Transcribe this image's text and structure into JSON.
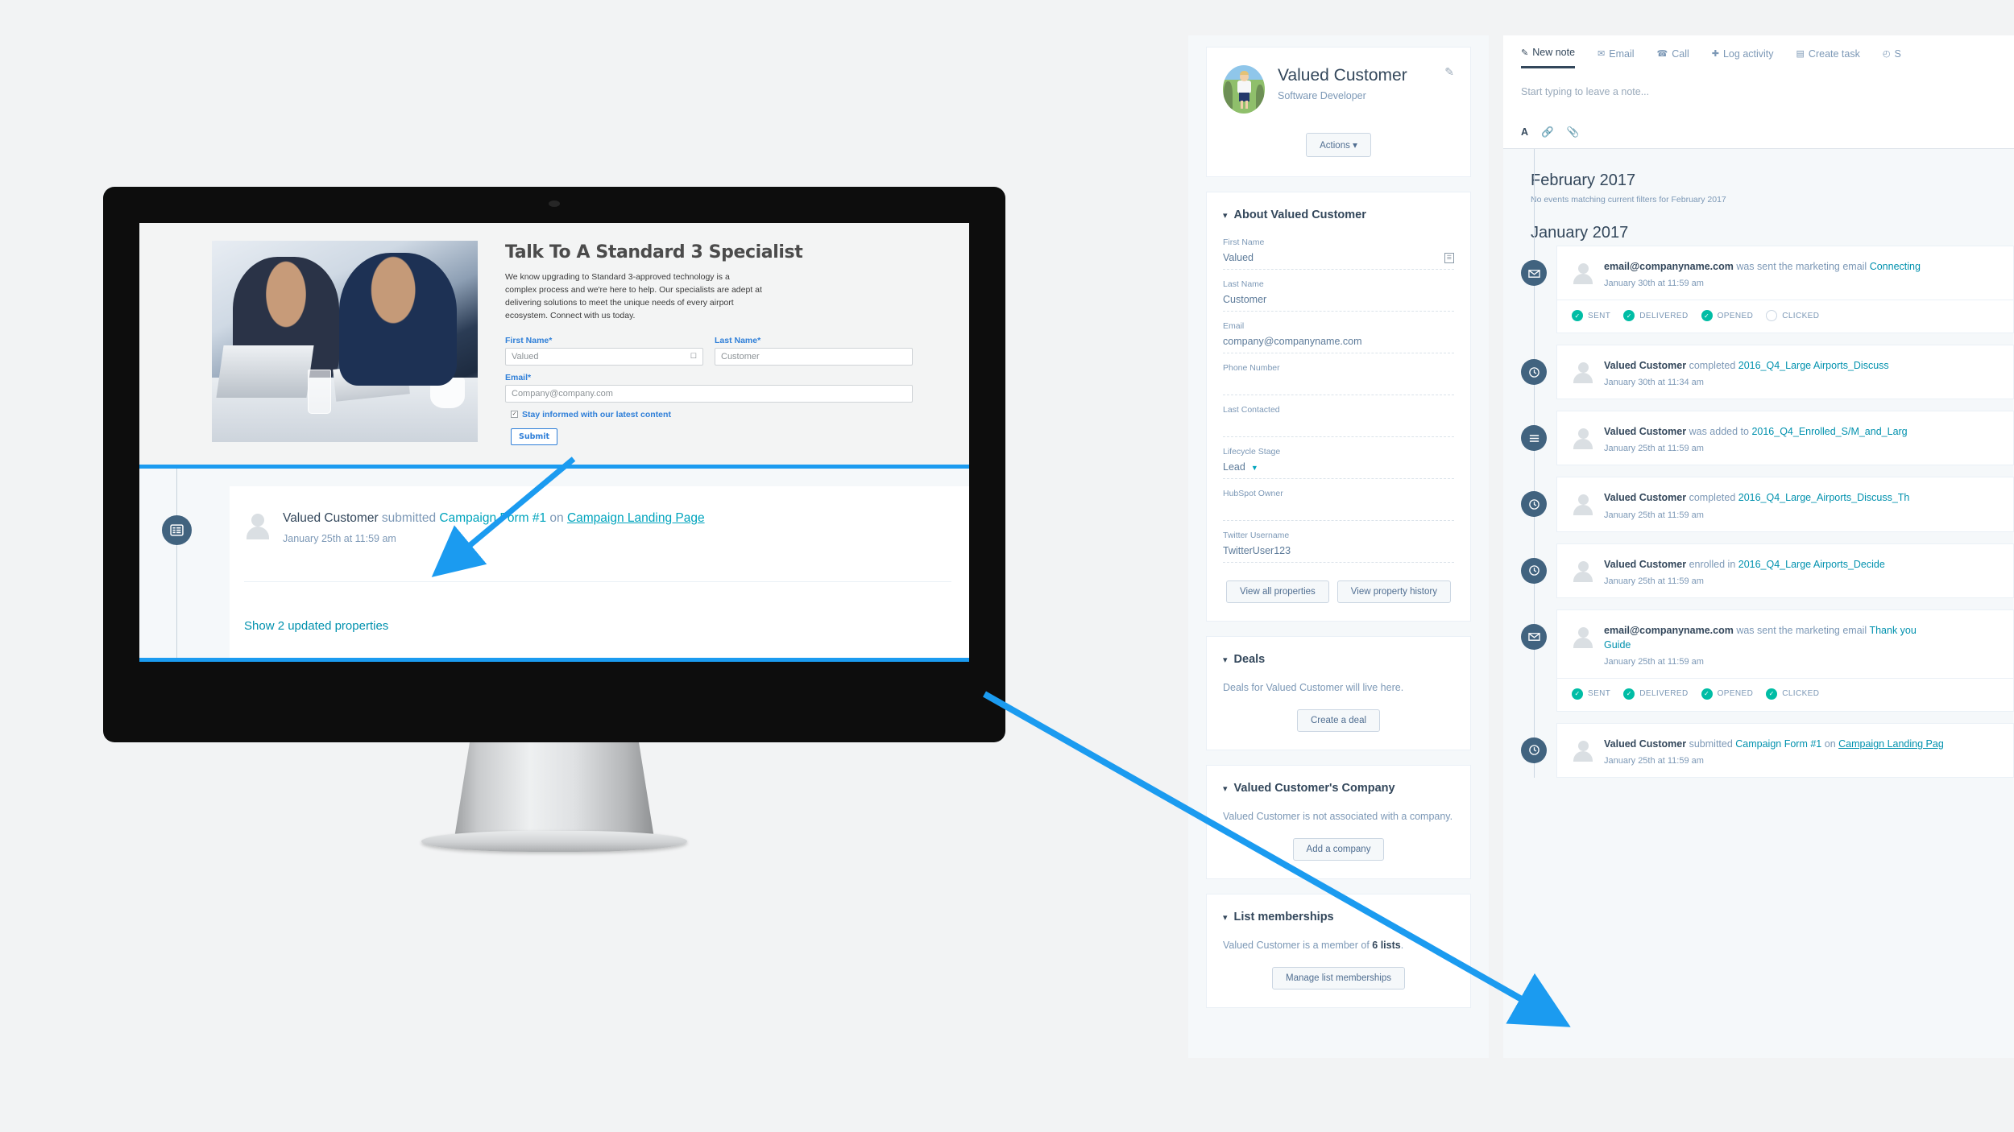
{
  "landing_page": {
    "title": "Talk To A Standard 3 Specialist",
    "body": "We know upgrading to Standard 3-approved technology is a complex process and we're here to help. Our specialists are adept at delivering solutions to meet the unique needs of every airport ecosystem. Connect with us today.",
    "fields": {
      "first_name_label": "First Name*",
      "first_name_value": "Valued",
      "last_name_label": "Last Name*",
      "last_name_value": "Customer",
      "email_label": "Email*",
      "email_value": "Company@company.com"
    },
    "checkbox_label": "Stay informed with our latest content",
    "submit_label": "Submit"
  },
  "highlight_event": {
    "actor": "Valued Customer",
    "verb": " submitted ",
    "form": "Campaign Form #1",
    "on": " on ",
    "page": "Campaign Landing Page",
    "timestamp": "January 25th at 11:59 am",
    "show_properties": "Show 2 updated properties"
  },
  "contact": {
    "name": "Valued Customer",
    "job_title": "Software Developer",
    "actions_label": "Actions",
    "actions_caret": "▾",
    "edit_icon": "pencil-icon"
  },
  "about": {
    "heading": "About Valued Customer",
    "chevron": "⌄",
    "properties": [
      {
        "label": "First Name",
        "value": "Valued",
        "copy": true
      },
      {
        "label": "Last Name",
        "value": "Customer"
      },
      {
        "label": "Email",
        "value": "company@companyname.com"
      },
      {
        "label": "Phone Number",
        "value": ""
      },
      {
        "label": "Last Contacted",
        "value": ""
      },
      {
        "label": "Lifecycle Stage",
        "value": "Lead",
        "caret": true
      },
      {
        "label": "HubSpot Owner",
        "value": ""
      },
      {
        "label": "Twitter Username",
        "value": "TwitterUser123"
      }
    ],
    "view_all_label": "View all properties",
    "view_history_label": "View property history"
  },
  "deals": {
    "heading": "Deals",
    "empty_text": "Deals for Valued Customer will live here.",
    "cta_label": "Create a deal"
  },
  "company": {
    "heading": "Valued Customer's Company",
    "empty_text": "Valued Customer is not associated with a company.",
    "cta_label": "Add a company"
  },
  "lists": {
    "heading": "List memberships",
    "empty_prefix": "Valued Customer is a member of ",
    "empty_count": "6 lists",
    "empty_suffix": ".",
    "cta_label": "Manage list memberships"
  },
  "note_composer": {
    "tabs": [
      {
        "label": "New note",
        "icon": "note-icon",
        "active": true
      },
      {
        "label": "Email",
        "icon": "envelope-icon",
        "active": false
      },
      {
        "label": "Call",
        "icon": "phone-icon",
        "active": false
      },
      {
        "label": "Log activity",
        "icon": "plus-icon",
        "active": false
      },
      {
        "label": "Create task",
        "icon": "task-icon",
        "active": false
      },
      {
        "label": "S",
        "icon": "clock-icon",
        "active": false
      }
    ],
    "placeholder": "Start typing to leave a note...",
    "tools": [
      "A",
      "⚭",
      "📎"
    ]
  },
  "timeline": {
    "months": [
      {
        "heading": "February 2017",
        "empty": "No events matching current filters for February 2017"
      },
      {
        "heading": "January 2017",
        "empty": ""
      }
    ],
    "events": [
      {
        "icon": "email-icon",
        "subject": "email@companyname.com",
        "verb": " was sent the marketing email ",
        "object": "Connecting",
        "object_link": true,
        "second_line": "",
        "time": "January 30th at 11:59 am",
        "states": [
          {
            "label": "SENT",
            "on": true
          },
          {
            "label": "DELIVERED",
            "on": true
          },
          {
            "label": "OPENED",
            "on": true
          },
          {
            "label": "CLICKED",
            "on": false
          }
        ]
      },
      {
        "icon": "workflow-icon",
        "subject": "Valued Customer",
        "verb": " completed ",
        "object": "2016_Q4_Large Airports_Discuss",
        "object_link": true,
        "second_line": "",
        "time": "January 30th at 11:34 am",
        "states": []
      },
      {
        "icon": "list-icon",
        "subject": "Valued Customer",
        "verb": " was added to ",
        "object": "2016_Q4_Enrolled_S/M_and_Larg",
        "object_link": true,
        "second_line": "",
        "time": "January 25th at 11:59 am",
        "states": []
      },
      {
        "icon": "workflow-icon",
        "subject": "Valued Customer",
        "verb": " completed ",
        "object": "2016_Q4_Large_Airports_Discuss_Th",
        "object_link": true,
        "second_line": "",
        "time": "January 25th at 11:59 am",
        "states": []
      },
      {
        "icon": "workflow-icon",
        "subject": "Valued Customer",
        "verb": " enrolled in ",
        "object": "2016_Q4_Large Airports_Decide",
        "object_link": true,
        "second_line": "",
        "time": "January 25th at 11:59 am",
        "states": []
      },
      {
        "icon": "email-icon",
        "subject": "email@companyname.com",
        "verb": " was sent the marketing email ",
        "object": "Thank you",
        "object_link": true,
        "second_line": "Guide",
        "time": "January 25th at 11:59 am",
        "states": [
          {
            "label": "SENT",
            "on": true
          },
          {
            "label": "DELIVERED",
            "on": true
          },
          {
            "label": "OPENED",
            "on": true
          },
          {
            "label": "CLICKED",
            "on": true
          }
        ]
      },
      {
        "icon": "form-icon",
        "subject": "Valued Customer",
        "verb": " submitted ",
        "object": "Campaign Form #1",
        "object_link": true,
        "tail_on": " on ",
        "tail_link": "Campaign Landing Pag",
        "second_line": "",
        "time": "January 25th at 11:59 am",
        "states": []
      }
    ]
  },
  "colors": {
    "accent_blue": "#1b9bf0",
    "link_teal": "#00a4bd",
    "hubspot_navy": "#33475b",
    "muted_blue": "#7c98b6",
    "success_green": "#00bda5",
    "timeline_dot": "#41637f"
  }
}
